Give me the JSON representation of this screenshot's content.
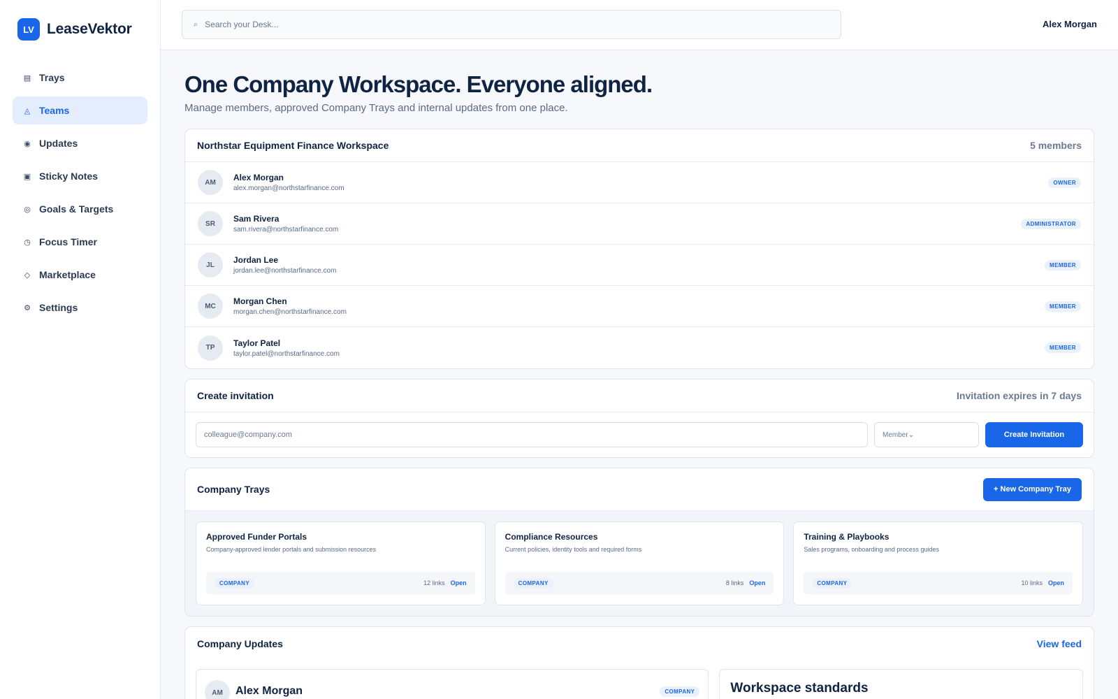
{
  "brand": {
    "mark": "LV",
    "name": "LeaseVektor"
  },
  "sidebar": {
    "items": [
      {
        "label": "Trays",
        "icon": "tray-icon",
        "glyph": "▤",
        "active": false
      },
      {
        "label": "Teams",
        "icon": "teams-icon",
        "glyph": "◬",
        "active": true
      },
      {
        "label": "Updates",
        "icon": "updates-icon",
        "glyph": "◉",
        "active": false
      },
      {
        "label": "Sticky Notes",
        "icon": "sticky-note-icon",
        "glyph": "▣",
        "active": false
      },
      {
        "label": "Goals & Targets",
        "icon": "target-icon",
        "glyph": "◎",
        "active": false
      },
      {
        "label": "Focus Timer",
        "icon": "timer-icon",
        "glyph": "◷",
        "active": false
      },
      {
        "label": "Marketplace",
        "icon": "marketplace-icon",
        "glyph": "◇",
        "active": false
      },
      {
        "label": "Settings",
        "icon": "settings-icon",
        "glyph": "⚙",
        "active": false
      }
    ]
  },
  "topbar": {
    "search_placeholder": "Search your Desk...",
    "search_glyph": "⌕",
    "user_name": "Alex Morgan"
  },
  "page": {
    "title": "One Company Workspace. Everyone aligned.",
    "subtitle": "Manage members, approved Company Trays and internal updates from one place."
  },
  "workspace": {
    "name": "Northstar Equipment Finance Workspace",
    "member_count": "5 members",
    "members": [
      {
        "initials": "AM",
        "name": "Alex Morgan",
        "email": "alex.morgan@northstarfinance.com",
        "role": "OWNER"
      },
      {
        "initials": "SR",
        "name": "Sam Rivera",
        "email": "sam.rivera@northstarfinance.com",
        "role": "ADMINISTRATOR"
      },
      {
        "initials": "JL",
        "name": "Jordan Lee",
        "email": "jordan.lee@northstarfinance.com",
        "role": "MEMBER"
      },
      {
        "initials": "MC",
        "name": "Morgan Chen",
        "email": "morgan.chen@northstarfinance.com",
        "role": "MEMBER"
      },
      {
        "initials": "TP",
        "name": "Taylor Patel",
        "email": "taylor.patel@northstarfinance.com",
        "role": "MEMBER"
      }
    ]
  },
  "invitation": {
    "title": "Create invitation",
    "expiry": "Invitation expires in 7 days",
    "email_placeholder": "colleague@company.com",
    "role_value": "Member",
    "role_glyph": "⌄",
    "button_label": "Create Invitation"
  },
  "trays": {
    "title": "Company Trays",
    "new_button": "+ New Company Tray",
    "items": [
      {
        "title": "Approved Funder Portals",
        "description": "Company-approved lender portals and submission resources",
        "tag": "COMPANY",
        "links": "12 links",
        "open": "Open"
      },
      {
        "title": "Compliance Resources",
        "description": "Current policies, identity tools and required forms",
        "tag": "COMPANY",
        "links": "8 links",
        "open": "Open"
      },
      {
        "title": "Training & Playbooks",
        "description": "Sales programs, onboarding and process guides",
        "tag": "COMPANY",
        "links": "10 links",
        "open": "Open"
      }
    ]
  },
  "updates": {
    "title": "Company Updates",
    "view_feed": "View feed",
    "post": {
      "initials": "AM",
      "author": "Alex Morgan",
      "tag": "COMPANY"
    },
    "standards_title": "Workspace standards"
  },
  "colors": {
    "accent": "#1a66e8",
    "text": "#0f2342",
    "muted": "#6b7a90",
    "background": "#f6f8fb"
  }
}
